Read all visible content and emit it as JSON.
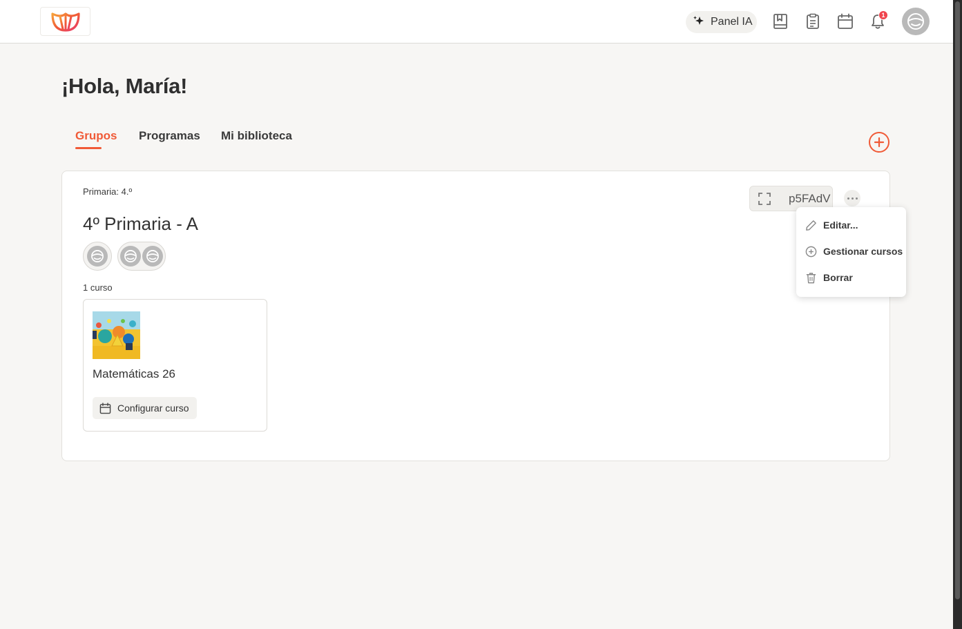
{
  "header": {
    "panel_ia_label": "Panel IA",
    "notification_count": "1"
  },
  "greeting": "¡Hola, María!",
  "tabs": [
    {
      "label": "Grupos",
      "active": true
    },
    {
      "label": "Programas",
      "active": false
    },
    {
      "label": "Mi biblioteca",
      "active": false
    }
  ],
  "group": {
    "level": "Primaria: 4.º",
    "title": "4º Primaria - A",
    "course_count": "1 curso",
    "code": "p5FAdV",
    "course": {
      "name": "Matemáticas 26",
      "config_label": "Configurar curso"
    }
  },
  "menu": {
    "edit_label": "Editar...",
    "manage_label": "Gestionar cursos",
    "delete_label": "Borrar"
  },
  "colors": {
    "accent": "#f05a37",
    "background": "#f7f6f4",
    "badge": "#f0454e"
  }
}
